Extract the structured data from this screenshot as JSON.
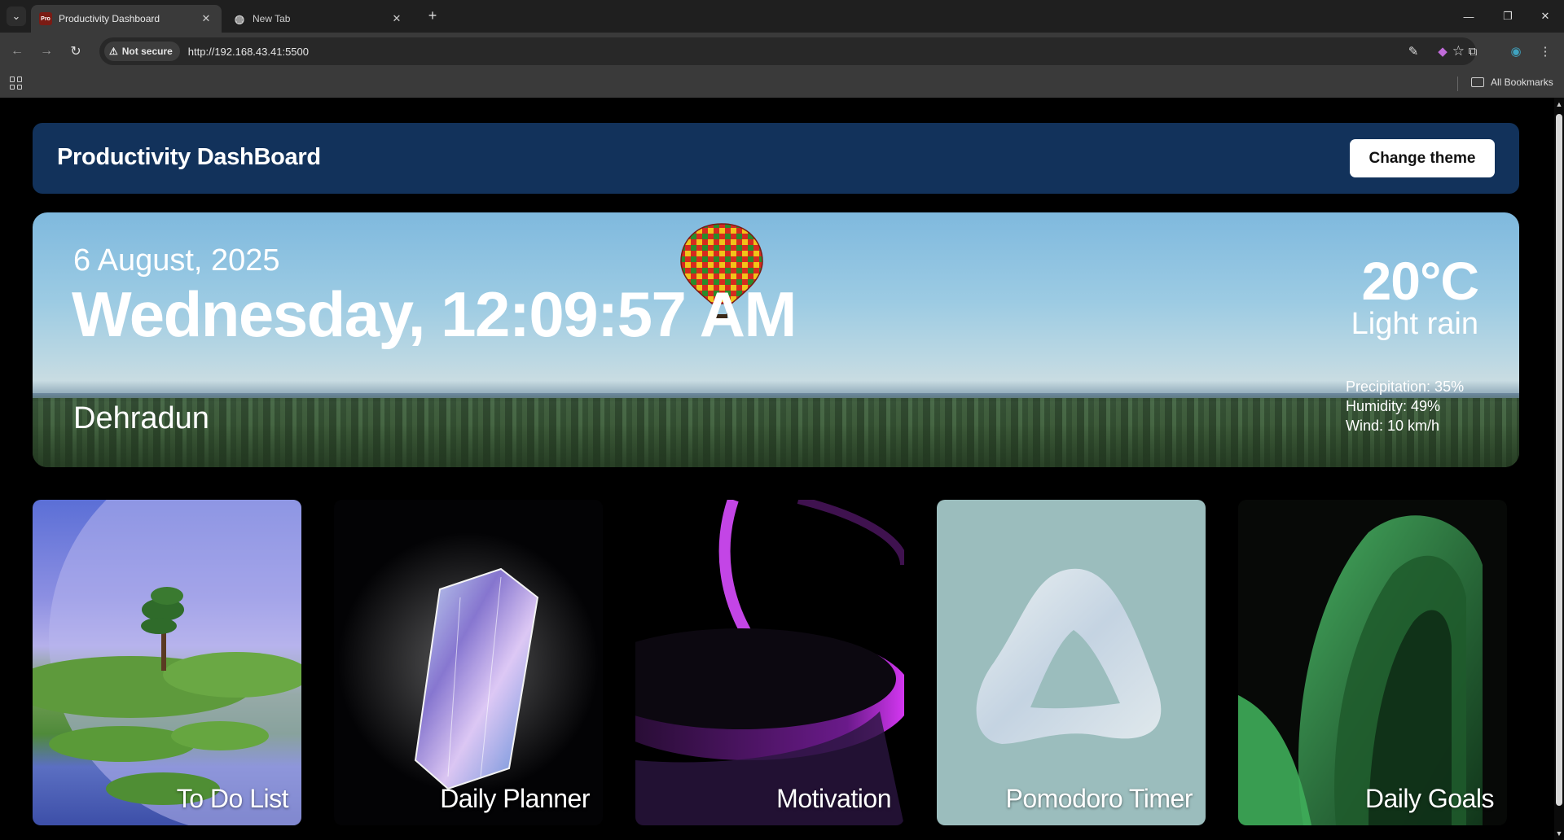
{
  "browser": {
    "tabs": [
      {
        "title": "Productivity Dashboard",
        "favicon": "Pro"
      },
      {
        "title": "New Tab"
      }
    ],
    "security_label": "Not secure",
    "url": "http://192.168.43.41:5500",
    "bookmarks_label": "All Bookmarks"
  },
  "navbar": {
    "brand": "Productivity DashBoard",
    "theme_button": "Change theme",
    "background": "#12325b"
  },
  "hero": {
    "date": "6 August, 2025",
    "day_time": "Wednesday, 12:09:57 AM",
    "city": "Dehradun",
    "temperature": "20°C",
    "condition": "Light rain",
    "precipitation": "Precipitation: 35%",
    "humidity": "Humidity: 49%",
    "wind": "Wind: 10 km/h"
  },
  "cards": [
    {
      "label": "To Do List"
    },
    {
      "label": "Daily Planner"
    },
    {
      "label": "Motivation"
    },
    {
      "label": "Pomodoro Timer"
    },
    {
      "label": "Daily Goals"
    }
  ]
}
